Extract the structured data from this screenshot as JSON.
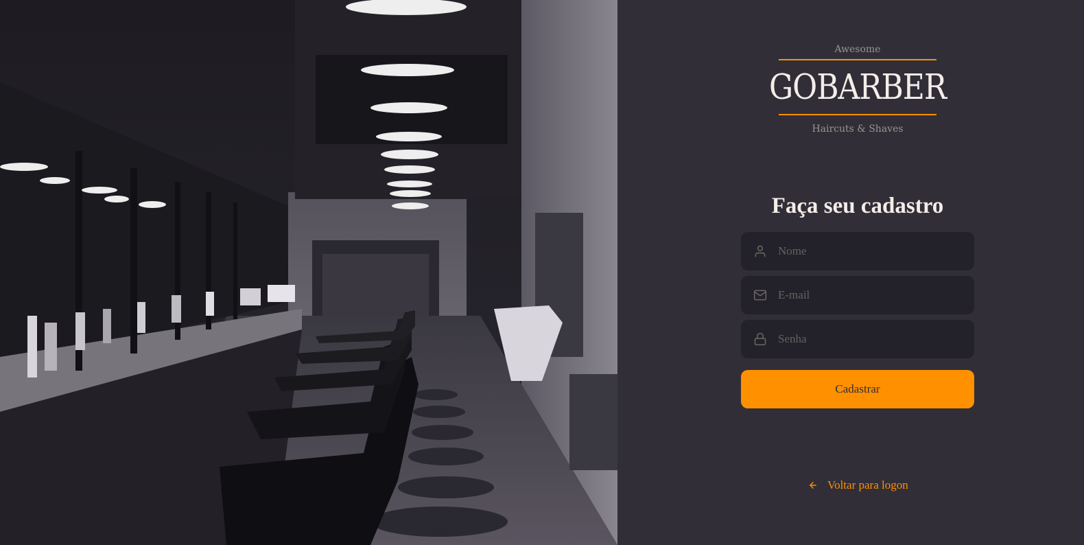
{
  "brand": {
    "top": "Awesome",
    "name": "GOBARBER",
    "bottom": "Haircuts & Shaves",
    "accent": "#ff9000"
  },
  "photo": {
    "description_icon": "barbershop-photo"
  },
  "form": {
    "title": "Faça seu cadastro",
    "name_placeholder": "Nome",
    "email_placeholder": "E-mail",
    "password_placeholder": "Senha",
    "submit_label": "Cadastrar"
  },
  "back_link": {
    "label": "Voltar para logon",
    "icon": "arrow-left-icon"
  },
  "colors": {
    "background": "#312e38",
    "input_bg": "#232129",
    "placeholder": "#666360",
    "text": "#f4ede8",
    "muted": "#999591",
    "orange": "#ff9000"
  }
}
